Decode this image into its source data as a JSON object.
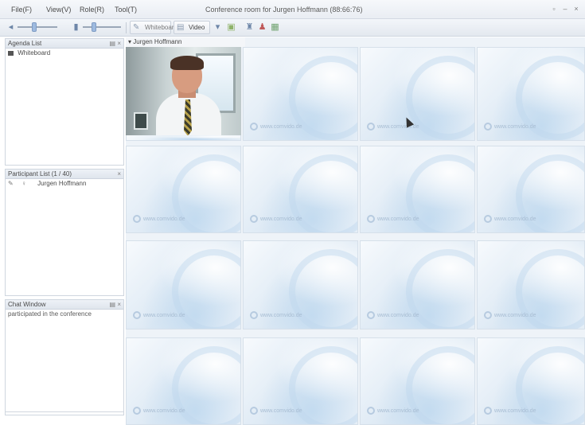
{
  "menu": {
    "items": [
      "File(F)",
      "View(V)",
      "Role(R)",
      "Tool(T)"
    ],
    "window_title": "Conference room for Jurgen Hoffmann (88:66:76)"
  },
  "toolbar": {
    "layout_button_label": "Video",
    "disabled_button_label": "Whiteboard"
  },
  "agenda_panel": {
    "title": "Agenda List",
    "items": [
      {
        "label": "Whiteboard",
        "icon": "whiteboard-icon"
      }
    ]
  },
  "participant_panel": {
    "title": "Participant List (1 / 40)",
    "participants": [
      {
        "name": "Jurgen Hoffmann",
        "icons": [
          "pen-icon",
          "mic-icon"
        ]
      }
    ]
  },
  "chat_panel": {
    "title": "Chat Window",
    "messages": [
      "participated in the conference"
    ]
  },
  "video": {
    "tab_label": "Jurgen Hoffmann",
    "active_participant": "Jurgen Hoffmann",
    "empty_tile_logo_text": "www.comvido.de",
    "grid_rows": 4,
    "grid_cols": 4
  },
  "colors": {
    "accent": "#9ebadf",
    "tile_background": "#dde9f4",
    "panel_border": "#cfd6df"
  }
}
